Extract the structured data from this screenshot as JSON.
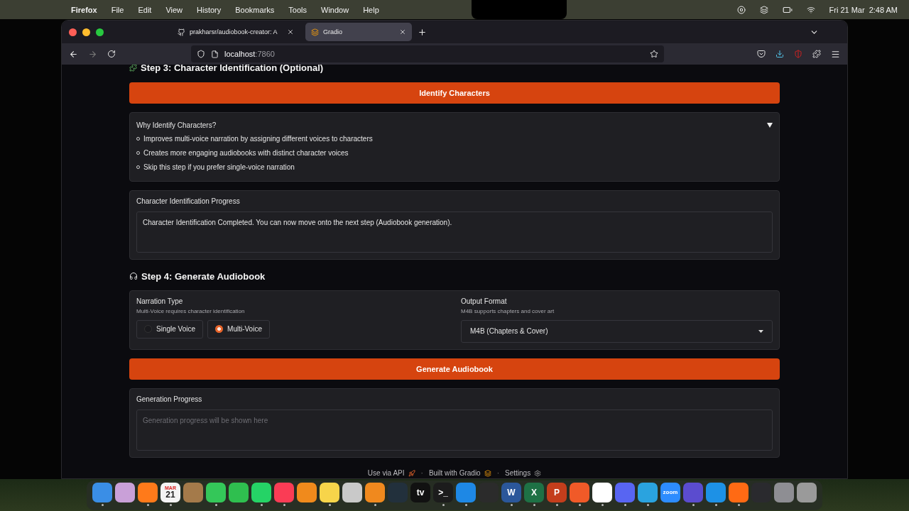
{
  "menu_bar": {
    "app": "Firefox",
    "menus": [
      "File",
      "Edit",
      "View",
      "History",
      "Bookmarks",
      "Tools",
      "Window",
      "Help"
    ],
    "date": "Fri 21 Mar",
    "time": "2:48 AM"
  },
  "browser": {
    "tabs": [
      {
        "title": "prakharsr/audiobook-creator: A",
        "kind": "github",
        "selected": false
      },
      {
        "title": "Gradio",
        "kind": "gradio",
        "selected": true
      }
    ],
    "url_host": "localhost",
    "url_port": ":7860"
  },
  "step3": {
    "heading": "Step 3: Character Identification (Optional)",
    "button": "Identify Characters",
    "accordion": {
      "title": "Why Identify Characters?",
      "expanded": true,
      "items": [
        "Improves multi-voice narration by assigning different voices to characters",
        "Creates more engaging audiobooks with distinct character voices",
        "Skip this step if you prefer single-voice narration"
      ]
    },
    "progress": {
      "label": "Character Identification Progress",
      "value": "Character Identification Completed. You can now move onto the next step (Audiobook generation)."
    }
  },
  "step4": {
    "heading": "Step 4: Generate Audiobook",
    "narration": {
      "label": "Narration Type",
      "info": "Multi-Voice requires character identification",
      "options": [
        {
          "label": "Single Voice",
          "selected": false
        },
        {
          "label": "Multi-Voice",
          "selected": true
        }
      ]
    },
    "format": {
      "label": "Output Format",
      "info": "M4B supports chapters and cover art",
      "value": "M4B (Chapters & Cover)"
    },
    "button": "Generate Audiobook",
    "progress": {
      "label": "Generation Progress",
      "placeholder": "Generation progress will be shown here"
    }
  },
  "footer_separator": "·",
  "footer": [
    {
      "label": "Use via API",
      "kind": "api"
    },
    {
      "label": "Built with Gradio",
      "kind": "gradio"
    },
    {
      "label": "Settings",
      "kind": "settings"
    }
  ],
  "dock": [
    {
      "color": "#3a8ee6",
      "running": true
    },
    {
      "color": "#c9a0d8",
      "running": false
    },
    {
      "color": "#ff7a1a",
      "running": true
    },
    {
      "color": "#f4f4f4",
      "running": true,
      "month": "MAR",
      "label": "21"
    },
    {
      "color": "#a47a4a",
      "running": false
    },
    {
      "color": "#34c759",
      "running": true
    },
    {
      "color": "#2fbf4f",
      "running": false
    },
    {
      "color": "#25d366",
      "running": true
    },
    {
      "color": "#fa3c55",
      "running": true
    },
    {
      "color": "#f08a1c",
      "running": false
    },
    {
      "color": "#f7d44a",
      "running": true
    },
    {
      "color": "#c9c9c9",
      "running": false
    },
    {
      "color": "#f0891e",
      "running": true
    },
    {
      "color": "#22303c",
      "running": false
    },
    {
      "color": "#111111",
      "running": false,
      "label": "tv"
    },
    {
      "color": "#1c1c1c",
      "running": true,
      "label": ">_"
    },
    {
      "color": "#1e88e5",
      "running": true
    },
    {
      "color": "#2b2b2b",
      "running": false
    },
    {
      "color": "#2b579a",
      "running": true,
      "label": "W"
    },
    {
      "color": "#1e7145",
      "running": true,
      "label": "X"
    },
    {
      "color": "#c43e1c",
      "running": true,
      "label": "P"
    },
    {
      "color": "#f05a28",
      "running": true
    },
    {
      "color": "#ffffff",
      "running": true
    },
    {
      "color": "#5865f2",
      "running": true
    },
    {
      "color": "#2aa3df",
      "running": true
    },
    {
      "color": "#2d8cff",
      "running": false,
      "label": "zoom"
    },
    {
      "color": "#5b4ccf",
      "running": true
    },
    {
      "color": "#1d91e6",
      "running": true
    },
    {
      "color": "#ff6a14",
      "running": true
    },
    {
      "color": "#2a2a2e",
      "running": false
    },
    {
      "color": "#8e8e93",
      "running": false
    },
    {
      "color": "#9a9a9a",
      "running": false
    }
  ]
}
